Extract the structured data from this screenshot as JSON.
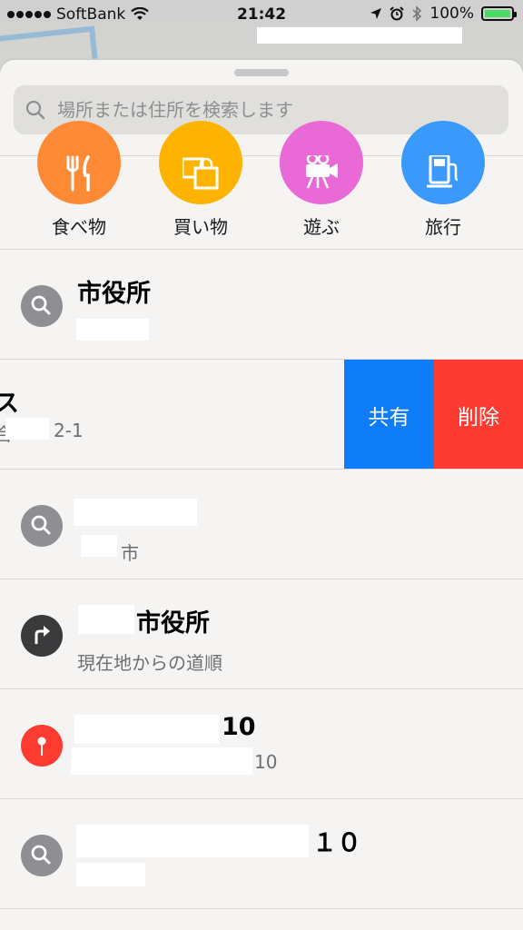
{
  "status_bar": {
    "carrier": "SoftBank",
    "time": "21:42",
    "battery": "100%",
    "battery_level": 1.0,
    "icons": [
      "signal-dots-icon",
      "wifi-icon",
      "location-arrow-icon",
      "alarm-icon",
      "bluetooth-icon",
      "battery-icon"
    ]
  },
  "search": {
    "placeholder": "場所または住所を検索します"
  },
  "categories": [
    {
      "label": "食べ物",
      "color": "#fe8a36",
      "icon": "fork-knife-icon"
    },
    {
      "label": "買い物",
      "color": "#fdb300",
      "icon": "shopping-bag-icon"
    },
    {
      "label": "遊ぶ",
      "color": "#e96ad6",
      "icon": "movie-camera-icon"
    },
    {
      "label": "旅行",
      "color": "#3a99fb",
      "icon": "gas-station-icon"
    }
  ],
  "results": [
    {
      "title": "市役所",
      "subtitle": "",
      "icon": "search-icon",
      "icon_color": "#8e8e93"
    },
    {
      "title": "ス",
      "subtitle": "2-1",
      "icon": "search-icon",
      "icon_color": "#8e8e93"
    },
    {
      "title": "",
      "subtitle": "市",
      "icon": "search-icon",
      "icon_color": "#8e8e93"
    },
    {
      "title": "市役所",
      "subtitle": "現在地からの道順",
      "icon": "directions-arrow-icon",
      "icon_color": "#3a3a3c"
    },
    {
      "title": "10",
      "subtitle": "10",
      "icon": "map-pin-icon",
      "icon_color": "#fd3b30"
    },
    {
      "title": "１０",
      "subtitle": "",
      "icon": "search-icon",
      "icon_color": "#8e8e93"
    }
  ],
  "swipe_actions": {
    "share": "共有",
    "delete": "削除",
    "share_color": "#0e7cf6",
    "delete_color": "#fd3a31"
  }
}
